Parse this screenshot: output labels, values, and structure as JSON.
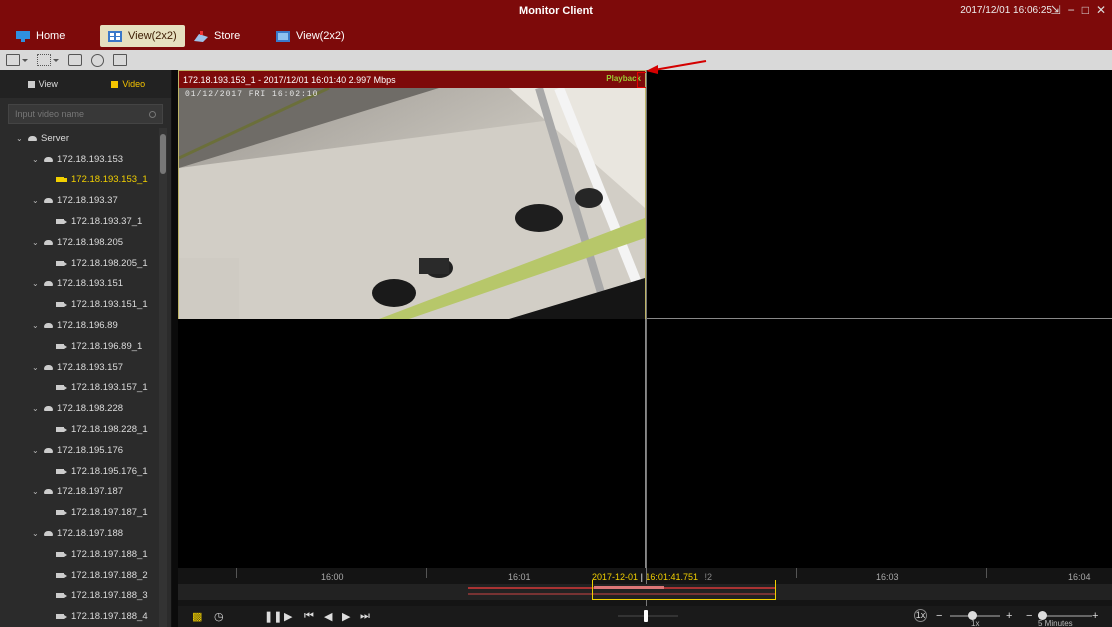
{
  "titlebar": {
    "title": "Monitor Client",
    "clock": "2017/12/01 16:06:25",
    "controls": [
      "⇲",
      "−",
      "□",
      "✕"
    ]
  },
  "tabs": [
    {
      "label": "Home",
      "icon": "monitor-icon"
    },
    {
      "label": "View(2x2)",
      "icon": "grid-view-icon",
      "active": true
    },
    {
      "label": "Store",
      "icon": "store-icon"
    },
    {
      "label": "View(2x2)",
      "icon": "grid-view-icon"
    }
  ],
  "sidebar": {
    "tabs": [
      {
        "label": "View",
        "icon": "grid-icon"
      },
      {
        "label": "Video",
        "icon": "camera-icon",
        "active": true
      }
    ],
    "search_placeholder": "Input video name",
    "tree": [
      {
        "level": 0,
        "label": "Server",
        "type": "server"
      },
      {
        "level": 1,
        "label": "172.18.193.153",
        "type": "server"
      },
      {
        "level": 2,
        "label": "172.18.193.153_1",
        "type": "camera",
        "selected": true
      },
      {
        "level": 1,
        "label": "172.18.193.37",
        "type": "server"
      },
      {
        "level": 2,
        "label": "172.18.193.37_1",
        "type": "camera"
      },
      {
        "level": 1,
        "label": "172.18.198.205",
        "type": "server"
      },
      {
        "level": 2,
        "label": "172.18.198.205_1",
        "type": "camera"
      },
      {
        "level": 1,
        "label": "172.18.193.151",
        "type": "server"
      },
      {
        "level": 2,
        "label": "172.18.193.151_1",
        "type": "camera"
      },
      {
        "level": 1,
        "label": "172.18.196.89",
        "type": "server"
      },
      {
        "level": 2,
        "label": "172.18.196.89_1",
        "type": "camera"
      },
      {
        "level": 1,
        "label": "172.18.193.157",
        "type": "server"
      },
      {
        "level": 2,
        "label": "172.18.193.157_1",
        "type": "camera"
      },
      {
        "level": 1,
        "label": "172.18.198.228",
        "type": "server"
      },
      {
        "level": 2,
        "label": "172.18.198.228_1",
        "type": "camera"
      },
      {
        "level": 1,
        "label": "172.18.195.176",
        "type": "server"
      },
      {
        "level": 2,
        "label": "172.18.195.176_1",
        "type": "camera"
      },
      {
        "level": 1,
        "label": "172.18.197.187",
        "type": "server"
      },
      {
        "level": 2,
        "label": "172.18.197.187_1",
        "type": "camera"
      },
      {
        "level": 1,
        "label": "172.18.197.188",
        "type": "server"
      },
      {
        "level": 2,
        "label": "172.18.197.188_1",
        "type": "camera"
      },
      {
        "level": 2,
        "label": "172.18.197.188_2",
        "type": "camera"
      },
      {
        "level": 2,
        "label": "172.18.197.188_3",
        "type": "camera"
      },
      {
        "level": 2,
        "label": "172.18.197.188_4",
        "type": "camera"
      }
    ]
  },
  "video": {
    "cell1_header": "172.18.193.153_1 - 2017/12/01 16:01:40 2.997 Mbps",
    "playback_label": "Playback",
    "osd": "01/12/2017 FRI 16:02:10"
  },
  "timeline": {
    "labels": [
      "16:00",
      "16:01",
      "16:03",
      "16:04"
    ],
    "current_date": "2017-12-01",
    "current_time": "16:01:41.751",
    "current_suffix": "!2"
  },
  "controls": {
    "speed_badge": "1x",
    "speed_label": "1x",
    "zoom_label": "5 Minutes"
  },
  "colors": {
    "accent": "#7d0a0a",
    "highlight": "#f2d000",
    "playback": "#9ccc33",
    "annotation": "#e60000"
  }
}
